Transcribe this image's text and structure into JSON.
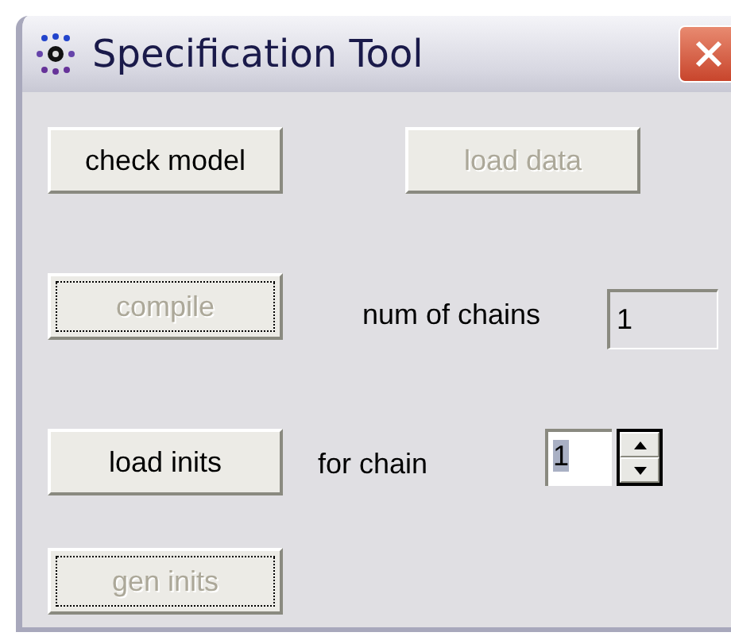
{
  "window": {
    "title": "Specification Tool"
  },
  "rows": [
    {
      "button": {
        "label": "check model",
        "disabled": false,
        "focused": false
      },
      "second_button": {
        "label": "load data",
        "disabled": true,
        "focused": false
      }
    },
    {
      "button": {
        "label": "compile",
        "disabled": true,
        "focused": true
      },
      "label": "num of chains",
      "field": {
        "value": "1",
        "kind": "text"
      }
    },
    {
      "button": {
        "label": "load inits",
        "disabled": false,
        "focused": false
      },
      "label": "for chain",
      "field": {
        "value": "1",
        "kind": "spinner"
      }
    },
    {
      "button": {
        "label": "gen inits",
        "disabled": true,
        "focused": true
      }
    }
  ]
}
